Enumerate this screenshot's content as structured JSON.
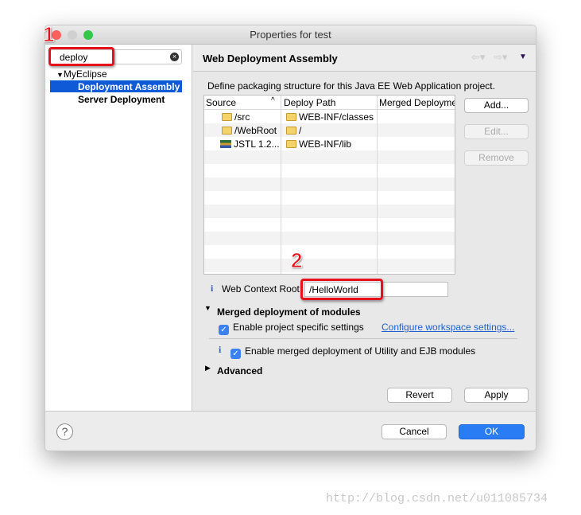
{
  "window": {
    "title": "Properties for test"
  },
  "filter": {
    "value": "deploy"
  },
  "tree": {
    "root": "MyEclipse",
    "items": [
      "Deployment Assembly",
      "Server Deployment"
    ]
  },
  "page": {
    "title": "Web Deployment Assembly",
    "description": "Define packaging structure for this Java EE Web Application project."
  },
  "table": {
    "headers": [
      "Source",
      "Deploy Path",
      "Merged Deployme"
    ],
    "rows": [
      {
        "source": "/src",
        "path": "WEB-INF/classes",
        "merged": ""
      },
      {
        "source": "/WebRoot",
        "path": "/",
        "merged": ""
      },
      {
        "source": "JSTL 1.2...",
        "path": "WEB-INF/lib",
        "merged": ""
      }
    ]
  },
  "buttons": {
    "add": "Add...",
    "edit": "Edit...",
    "remove": "Remove",
    "revert": "Revert",
    "apply": "Apply",
    "cancel": "Cancel",
    "ok": "OK"
  },
  "context_root": {
    "label": "Web Context Root:",
    "value": "/HelloWorld"
  },
  "merged": {
    "title": "Merged deployment of modules",
    "enable_project": "Enable project specific settings",
    "configure_link": "Configure workspace settings...",
    "enable_merged": "Enable merged deployment of Utility and EJB modules"
  },
  "advanced": {
    "title": "Advanced"
  },
  "annotations": {
    "one": "1",
    "two": "2"
  },
  "watermark": "http://blog.csdn.net/u011085734",
  "colors": {
    "selection": "#0f5ad7",
    "ok": "#2a7cf5",
    "link": "#1f5fd0",
    "annotation": "#e8101a"
  }
}
